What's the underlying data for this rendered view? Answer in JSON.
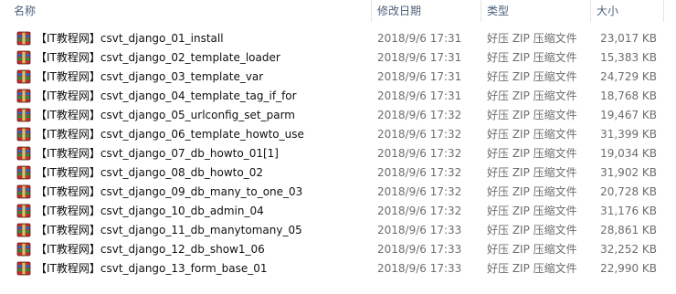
{
  "headers": {
    "name": "名称",
    "date": "修改日期",
    "type": "类型",
    "size": "大小"
  },
  "files": [
    {
      "name": "【IT教程网】csvt_django_01_install",
      "date": "2018/9/6 17:31",
      "type": "好压 ZIP 压缩文件",
      "size": "23,017 KB"
    },
    {
      "name": "【IT教程网】csvt_django_02_template_loader",
      "date": "2018/9/6 17:31",
      "type": "好压 ZIP 压缩文件",
      "size": "15,383 KB"
    },
    {
      "name": "【IT教程网】csvt_django_03_template_var",
      "date": "2018/9/6 17:31",
      "type": "好压 ZIP 压缩文件",
      "size": "24,729 KB"
    },
    {
      "name": "【IT教程网】csvt_django_04_template_tag_if_for",
      "date": "2018/9/6 17:31",
      "type": "好压 ZIP 压缩文件",
      "size": "18,768 KB"
    },
    {
      "name": "【IT教程网】csvt_django_05_urlconfig_set_parm",
      "date": "2018/9/6 17:32",
      "type": "好压 ZIP 压缩文件",
      "size": "19,467 KB"
    },
    {
      "name": "【IT教程网】csvt_django_06_template_howto_use",
      "date": "2018/9/6 17:32",
      "type": "好压 ZIP 压缩文件",
      "size": "31,399 KB"
    },
    {
      "name": "【IT教程网】csvt_django_07_db_howto_01[1]",
      "date": "2018/9/6 17:32",
      "type": "好压 ZIP 压缩文件",
      "size": "19,034 KB"
    },
    {
      "name": "【IT教程网】csvt_django_08_db_howto_02",
      "date": "2018/9/6 17:32",
      "type": "好压 ZIP 压缩文件",
      "size": "31,902 KB"
    },
    {
      "name": "【IT教程网】csvt_django_09_db_many_to_one_03",
      "date": "2018/9/6 17:32",
      "type": "好压 ZIP 压缩文件",
      "size": "20,728 KB"
    },
    {
      "name": "【IT教程网】csvt_django_10_db_admin_04",
      "date": "2018/9/6 17:32",
      "type": "好压 ZIP 压缩文件",
      "size": "31,176 KB"
    },
    {
      "name": "【IT教程网】csvt_django_11_db_manytomany_05",
      "date": "2018/9/6 17:33",
      "type": "好压 ZIP 压缩文件",
      "size": "28,861 KB"
    },
    {
      "name": "【IT教程网】csvt_django_12_db_show1_06",
      "date": "2018/9/6 17:33",
      "type": "好压 ZIP 压缩文件",
      "size": "32,252 KB"
    },
    {
      "name": "【IT教程网】csvt_django_13_form_base_01",
      "date": "2018/9/6 17:33",
      "type": "好压 ZIP 压缩文件",
      "size": "22,990 KB"
    }
  ],
  "icons": {
    "file": "zip-archive-icon"
  },
  "colors": {
    "header_text": "#4c607a",
    "divider": "#e5e5e5",
    "meta_text": "#6d6d6d",
    "icon_red": "#c62d2d",
    "icon_blue": "#2d65b8",
    "icon_green": "#2d8c3d"
  }
}
